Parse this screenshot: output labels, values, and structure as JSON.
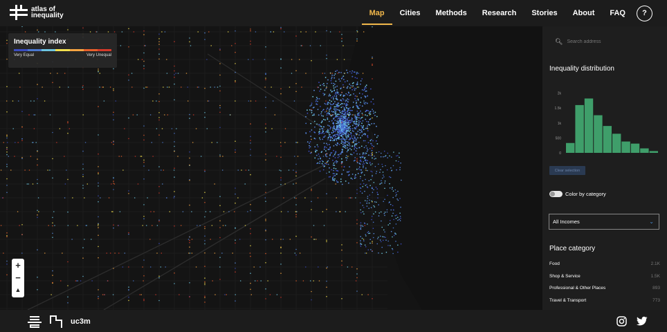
{
  "brand": {
    "name": "atlas of inequality"
  },
  "nav": {
    "items": [
      {
        "label": "Map",
        "active": true
      },
      {
        "label": "Cities"
      },
      {
        "label": "Methods"
      },
      {
        "label": "Research"
      },
      {
        "label": "Stories"
      },
      {
        "label": "About"
      },
      {
        "label": "FAQ"
      }
    ],
    "help_label": "?"
  },
  "legend": {
    "title": "Inequality index",
    "low_label": "Very Equal",
    "high_label": "Very Unequal",
    "colors": [
      "#3b4cc0",
      "#4a78d0",
      "#6ec6e0",
      "#f3e04f",
      "#f5a442",
      "#e8602c",
      "#d73a2a"
    ]
  },
  "map_controls": {
    "zoom_in": "+",
    "zoom_out": "−",
    "compass": "▲"
  },
  "panel": {
    "search": {
      "placeholder": "Search address"
    },
    "distribution_title": "Inequality distribution",
    "clear_selection_label": "Clear selection",
    "color_by_category_label": "Color by category",
    "income_select": {
      "value": "All Incomes"
    },
    "category_title": "Place category",
    "categories": [
      {
        "name": "Food",
        "count": "2.1K"
      },
      {
        "name": "Shop & Service",
        "count": "1.5K"
      },
      {
        "name": "Professional & Other Places",
        "count": "893"
      },
      {
        "name": "Travel & Transport",
        "count": "773"
      }
    ]
  },
  "chart_data": {
    "type": "bar",
    "title": "Inequality distribution",
    "y_ticks": [
      "2k",
      "1.5k",
      "1k",
      "500",
      "0"
    ],
    "ylim": [
      0,
      2200
    ],
    "values": [
      330,
      1600,
      1820,
      1260,
      900,
      640,
      380,
      310,
      150,
      60
    ],
    "bar_color": "#3f9e6a"
  },
  "footer": {
    "logo3_label": "uc3m",
    "social": [
      {
        "name": "instagram-icon"
      },
      {
        "name": "twitter-icon"
      }
    ]
  }
}
